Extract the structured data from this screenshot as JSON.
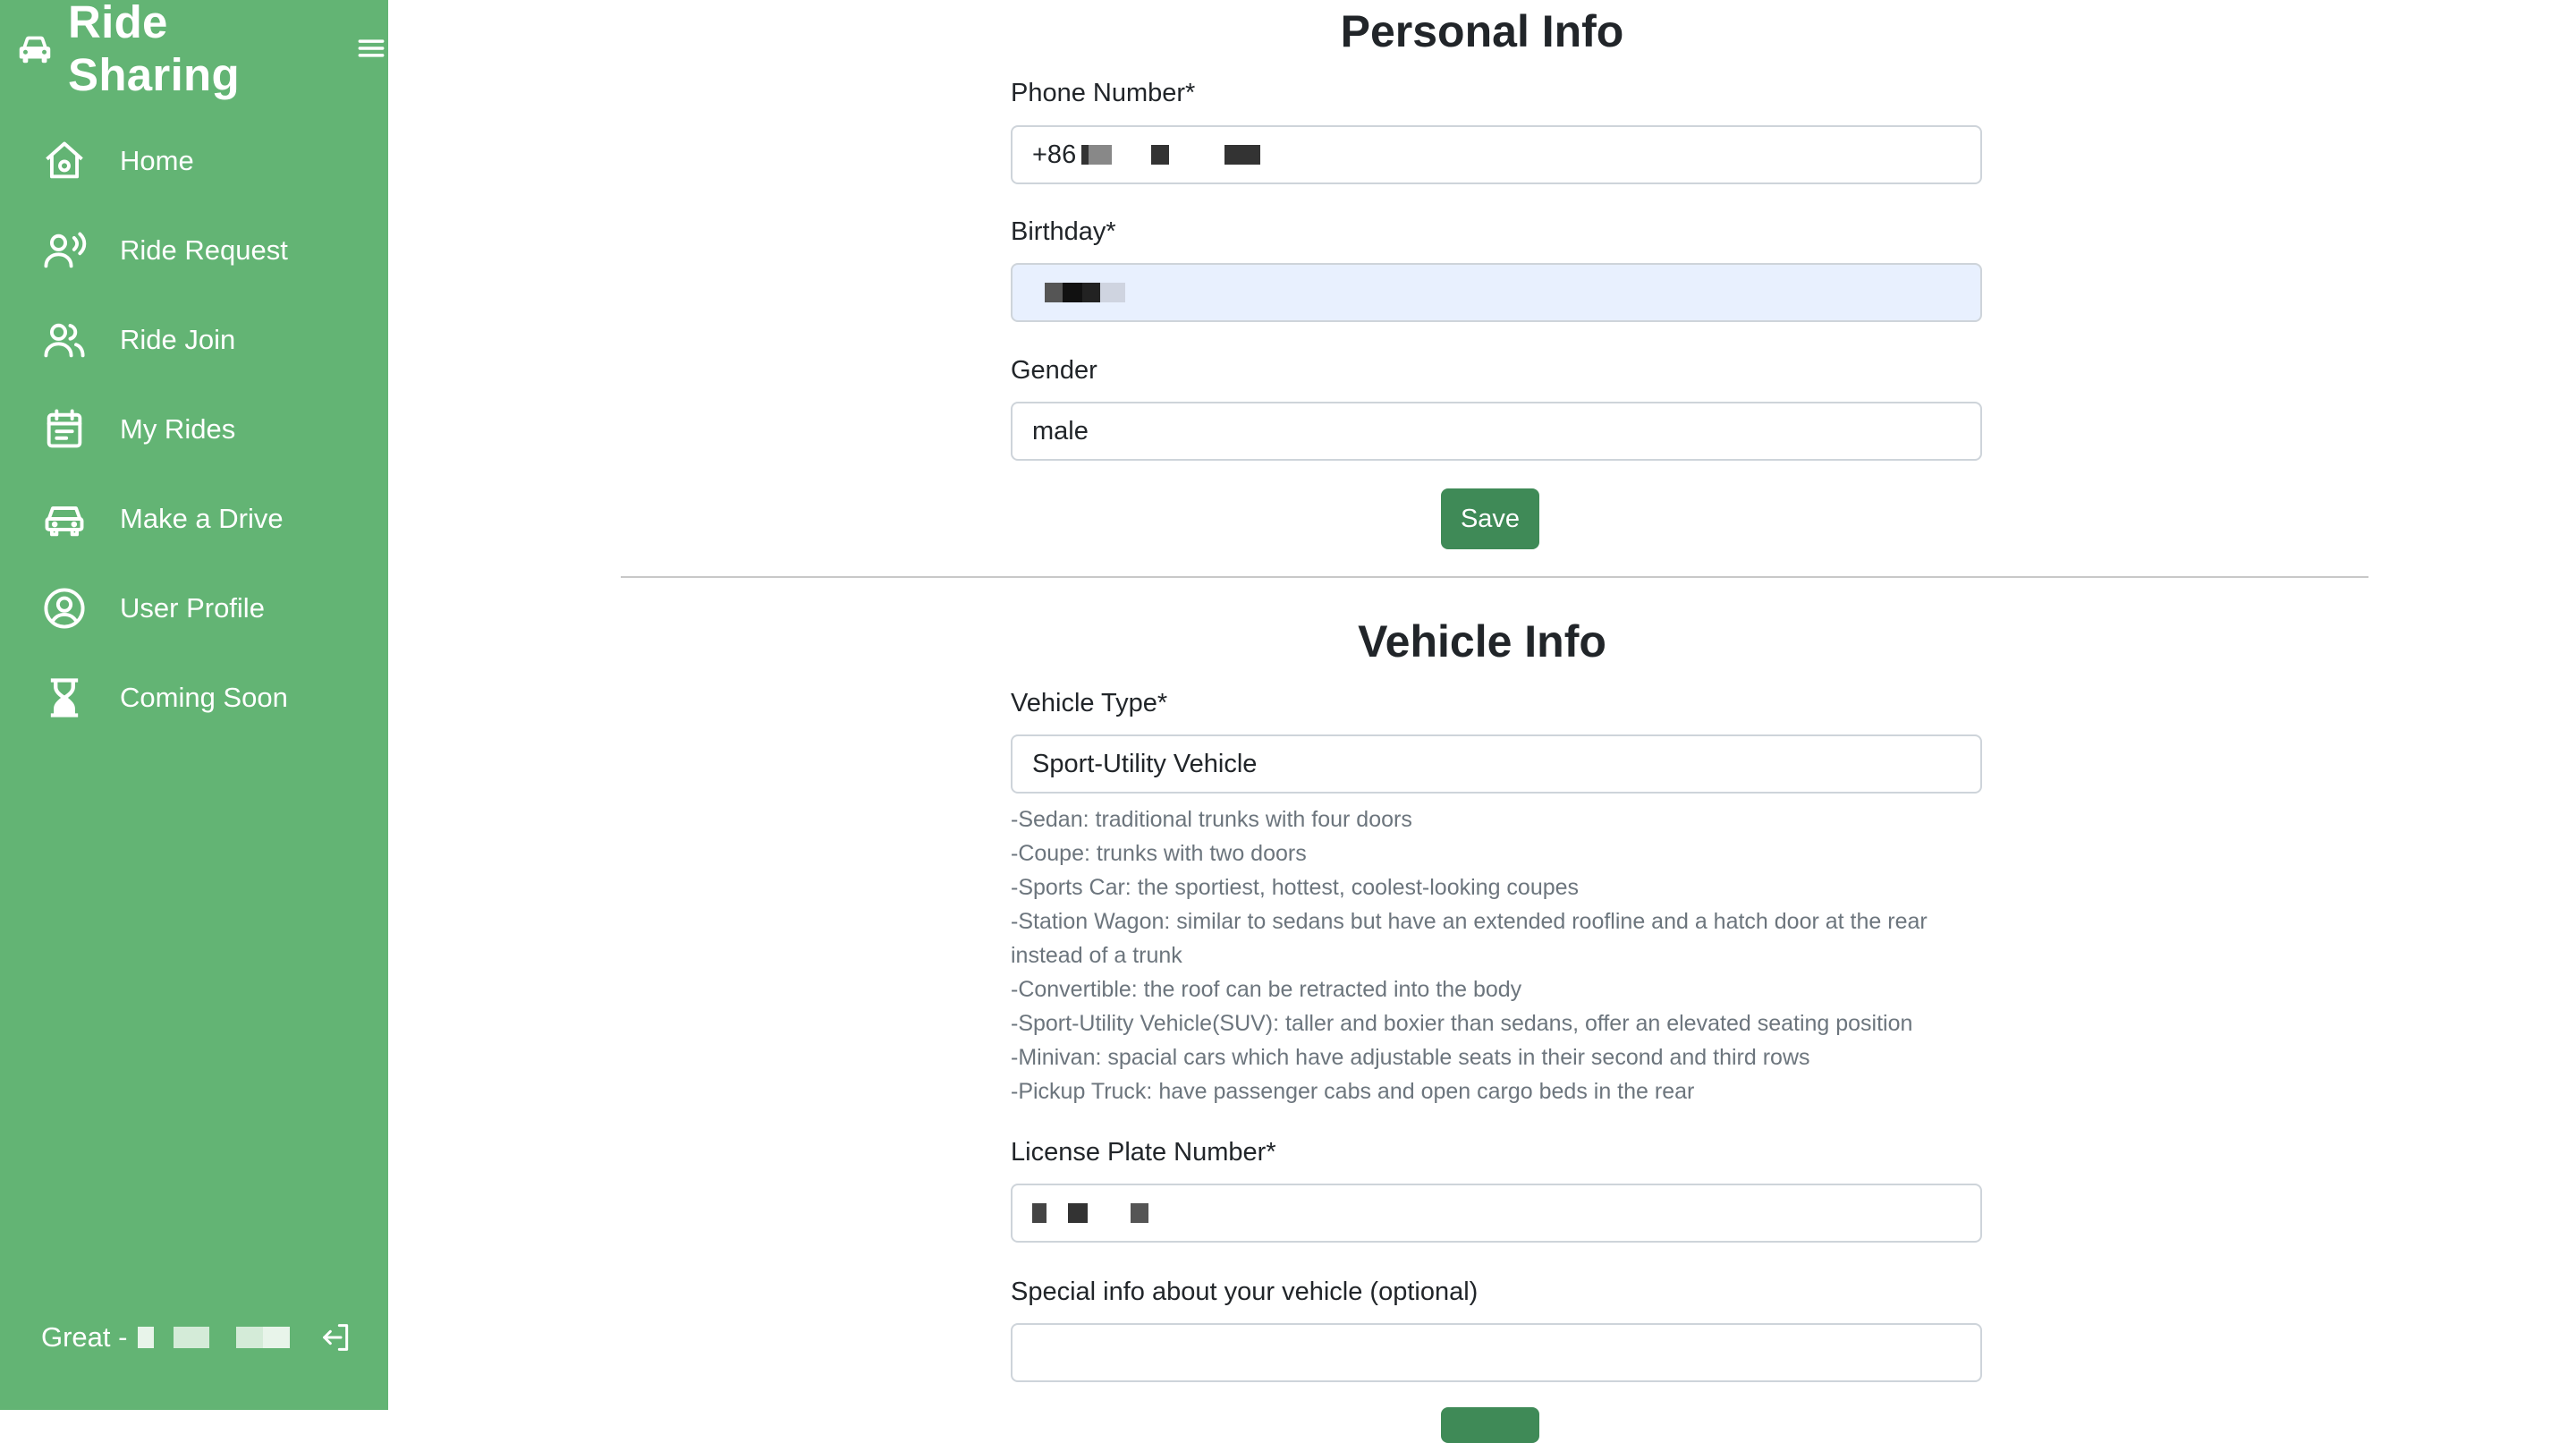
{
  "sidebar": {
    "brand": {
      "title": "Ride Sharing",
      "icon": "car-icon"
    },
    "menu_icon": "hamburger-menu-icon",
    "items": [
      {
        "label": "Home",
        "icon": "home-icon"
      },
      {
        "label": "Ride Request",
        "icon": "user-voice-icon"
      },
      {
        "label": "Ride Join",
        "icon": "users-icon"
      },
      {
        "label": "My Rides",
        "icon": "calendar-icon"
      },
      {
        "label": "Make a Drive",
        "icon": "car-icon"
      },
      {
        "label": "User Profile",
        "icon": "user-circle-icon"
      },
      {
        "label": "Coming Soon",
        "icon": "hourglass-icon"
      }
    ],
    "footer": {
      "greeting": "Great -",
      "logout_icon": "logout-icon"
    }
  },
  "personal_info": {
    "title": "Personal Info",
    "phone": {
      "label": "Phone Number*",
      "value": "+86"
    },
    "birthday": {
      "label": "Birthday*"
    },
    "gender": {
      "label": "Gender",
      "value": "male"
    },
    "save_label": "Save"
  },
  "vehicle_info": {
    "title": "Vehicle Info",
    "vehicle_type": {
      "label": "Vehicle Type*",
      "value": "Sport-Utility Vehicle",
      "help": [
        "-Sedan: traditional trunks with four doors",
        "-Coupe: trunks with two doors",
        "-Sports Car: the sportiest, hottest, coolest-looking coupes",
        "-Station Wagon: similar to sedans but have an extended roofline and a hatch door at the rear instead of a trunk",
        "-Convertible: the roof can be retracted into the body",
        "-Sport-Utility Vehicle(SUV): taller and boxier than sedans, offer an elevated seating position",
        "-Minivan: spacial cars which have adjustable seats in their second and third rows",
        "-Pickup Truck: have passenger cabs and open cargo beds in the rear"
      ]
    },
    "license_plate": {
      "label": "License Plate Number*"
    },
    "special_info": {
      "label": "Special info about your vehicle (optional)",
      "value": ""
    }
  },
  "colors": {
    "sidebar_bg": "#63b474",
    "button_bg": "#3f8a57",
    "autofill_bg": "#e8f0fe"
  }
}
